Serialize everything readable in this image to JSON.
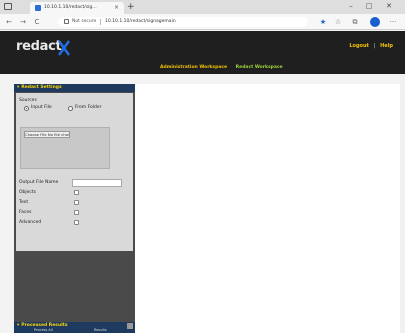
{
  "browser": {
    "tab_title": "10.10.1.10/redact/sig…",
    "tab_close": "×",
    "new_tab": "+",
    "minimize": "–",
    "maximize": "□",
    "close": "✕",
    "back": "←",
    "forward": "→",
    "reload": "C",
    "not_secure": "Not secure",
    "url": "10.10.1.10/redact/signagemain",
    "menu": "···"
  },
  "app": {
    "logo_text": "redact",
    "logo_color": "#1d6fe0",
    "top_links": {
      "logout": "Logout",
      "separator": "|",
      "help": "Help"
    },
    "nav": {
      "tab1": "Administration Workspace",
      "tab2": "Redact Workspace"
    },
    "accent_yellow": "#f2c200",
    "active_green": "#9fd23a",
    "panel_blue": "#1e3a5f"
  },
  "sidebar": {
    "settings_title": "Redact Settings",
    "sources_label": "Sources",
    "source_options": [
      {
        "label": "Input File",
        "selected": true
      },
      {
        "label": "From Folder",
        "selected": false
      }
    ],
    "choose_button": "Choose File  No file chosen",
    "output_name_label": "Output File Name",
    "output_name_value": "",
    "options": [
      {
        "label": "Objects",
        "checked": false
      },
      {
        "label": "Text",
        "checked": false
      },
      {
        "label": "Faces",
        "checked": false
      },
      {
        "label": "Advanced",
        "checked": false
      }
    ],
    "results_title": "Processed Results",
    "bottom_tabs": [
      "Process All",
      "Results"
    ]
  }
}
